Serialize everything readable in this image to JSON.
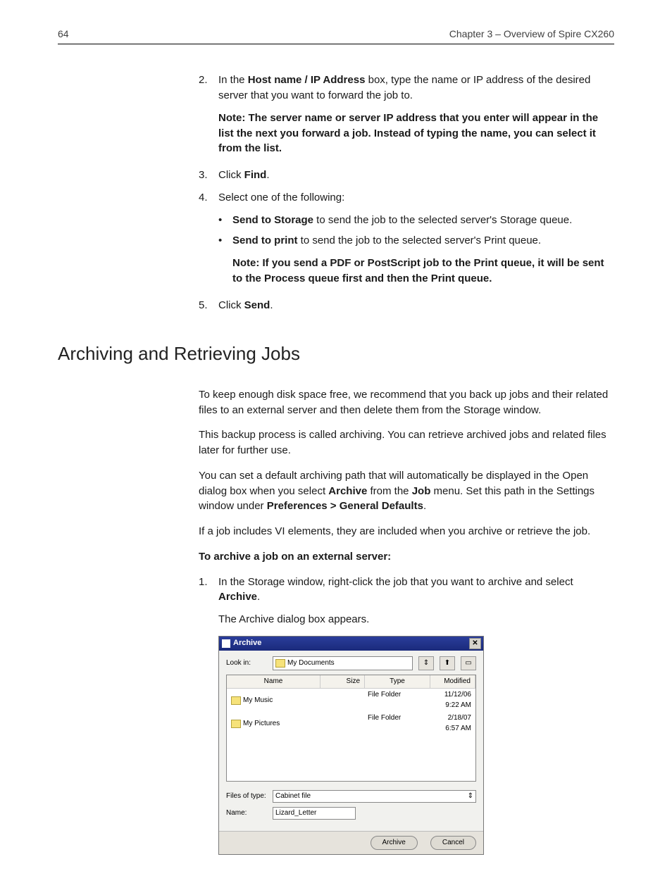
{
  "header": {
    "page_number": "64",
    "chapter": "Chapter 3 – Overview of Spire CX260"
  },
  "step2": {
    "num": "2.",
    "prefix": "In the ",
    "bold1": "Host name / IP Address",
    "rest": " box, type the name or IP address of the desired server that you want to forward the job to."
  },
  "note1": {
    "label": "Note:  ",
    "text": "The server name or server IP address that you enter will appear in the list the next you forward a job. Instead of typing the name, you can select it from the list."
  },
  "step3": {
    "num": "3.",
    "prefix": "Click ",
    "bold": "Find",
    "suffix": "."
  },
  "step4": {
    "num": "4.",
    "text": "Select one of the following:"
  },
  "bullet1": {
    "bold": "Send to Storage",
    "rest": " to send the job to the selected server's Storage queue."
  },
  "bullet2": {
    "bold": "Send to print",
    "rest": " to send the job to the selected server's Print queue."
  },
  "note2": {
    "label": "Note:  ",
    "text": "If you send a PDF or PostScript job to the Print queue, it will be sent to the Process queue first and then the Print queue."
  },
  "step5": {
    "num": "5.",
    "prefix": "Click ",
    "bold": "Send",
    "suffix": "."
  },
  "section_title": "Archiving and Retrieving Jobs",
  "para1": "To keep enough disk space free, we recommend that you back up jobs and their related files to an external server and then delete them from the Storage window.",
  "para2": "This backup process is called archiving. You can retrieve archived jobs and related files later for further use.",
  "para3": {
    "t1": "You can set a default archiving path that will automatically be displayed in the Open dialog box when you select ",
    "b1": "Archive",
    "t2": " from the ",
    "b2": "Job",
    "t3": " menu. Set this path in the Settings window under ",
    "b3": "Preferences > General Defaults",
    "t4": "."
  },
  "para4": "If a job includes VI elements, they are included when you archive or retrieve the job.",
  "subhead": "To archive a job on an external server:",
  "arch_step1": {
    "num": "1.",
    "t1": "In the Storage window, right-click the job that you want to archive and select ",
    "b1": "Archive",
    "t2": "."
  },
  "arch_step1_after": "The Archive dialog box appears.",
  "dialog": {
    "title": "Archive",
    "look_in_label": "Look in:",
    "look_in_value": "My Documents",
    "columns": {
      "name": "Name",
      "size": "Size",
      "type": "Type",
      "modified": "Modified"
    },
    "rows": [
      {
        "name": "My Music",
        "type": "File Folder",
        "modified": "11/12/06 9:22 AM"
      },
      {
        "name": "My Pictures",
        "type": "File Folder",
        "modified": "2/18/07 6:57 AM"
      }
    ],
    "files_of_type_label": "Files of type:",
    "files_of_type_value": "Cabinet file",
    "name_label": "Name:",
    "name_value": "Lizard_Letter",
    "archive_btn": "Archive",
    "cancel_btn": "Cancel"
  }
}
